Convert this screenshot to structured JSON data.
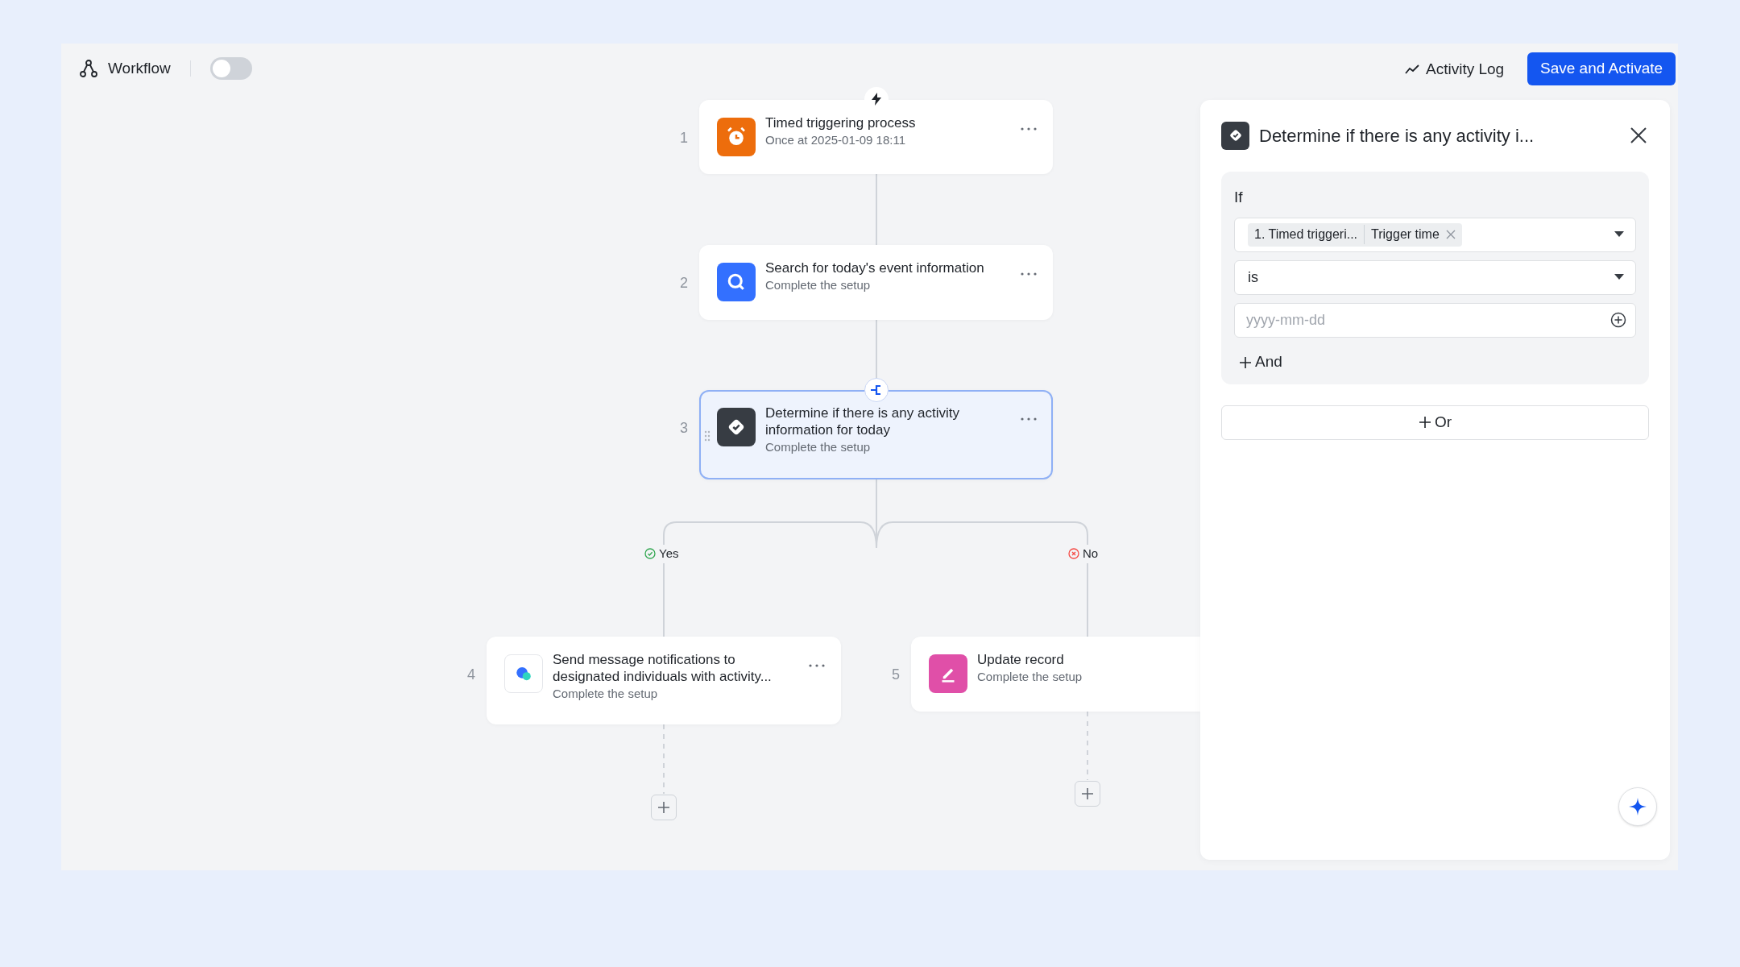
{
  "header": {
    "title": "Workflow",
    "enabled": false,
    "activity_log": "Activity Log",
    "save_button": "Save and Activate"
  },
  "nodes": [
    {
      "number": "1",
      "kind": "trigger",
      "title": "Timed triggering process",
      "subtitle": "Once at 2025-01-09 18:11",
      "selected": false
    },
    {
      "number": "2",
      "kind": "search",
      "title": "Search for today's event information",
      "subtitle": "Complete the setup",
      "selected": false
    },
    {
      "number": "3",
      "kind": "condition",
      "title": "Determine if there is any activity information for today",
      "subtitle": "Complete the setup",
      "selected": true
    },
    {
      "number": "4",
      "kind": "message",
      "title": "Send message notifications to designated individuals with activity...",
      "subtitle": "Complete the setup",
      "selected": false
    },
    {
      "number": "5",
      "kind": "update",
      "title": "Update record",
      "subtitle": "Complete the setup",
      "selected": false
    }
  ],
  "branches": [
    {
      "kind": "yes",
      "label": "Yes"
    },
    {
      "kind": "no",
      "label": "No"
    }
  ],
  "panel": {
    "title": "Determine if there is any activity i...",
    "if_label": "If",
    "source_tag": "1. Timed triggeri...",
    "field_tag": "Trigger time",
    "operator": "is",
    "value_placeholder": "yyyy-mm-dd",
    "and_button": "And",
    "or_button": "Or"
  }
}
